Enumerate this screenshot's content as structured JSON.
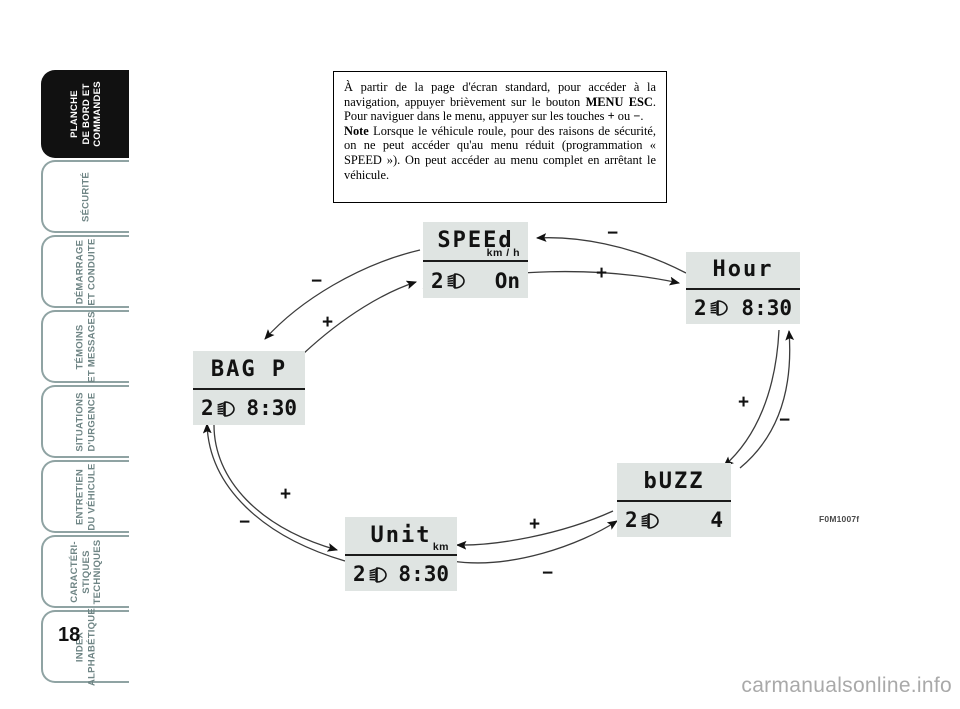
{
  "sidebar": {
    "items": [
      {
        "name": "planche-de-bord",
        "label": "PLANCHE\nDE BORD ET\nCOMMANDES",
        "active": true
      },
      {
        "name": "securite",
        "label": "SÉCURITÉ",
        "active": false
      },
      {
        "name": "demarrage",
        "label": "DÉMARRAGE\nET CONDUITE",
        "active": false
      },
      {
        "name": "temoins",
        "label": "TÉMOINS\nET MESSAGES",
        "active": false
      },
      {
        "name": "situations-urgence",
        "label": "SITUATIONS\nD'URGENCE",
        "active": false
      },
      {
        "name": "entretien",
        "label": "ENTRETIEN\nDU VÉHICULE",
        "active": false
      },
      {
        "name": "caracteristiques",
        "label": "CARACTÉRI-\nSTIQUES\nTECHNIQUES",
        "active": false
      },
      {
        "name": "index",
        "label": "INDEX\nALPHABÉTIQUE",
        "active": false
      }
    ],
    "page_number": "18"
  },
  "note": {
    "paragraph1_a": "À partir de la page d'écran standard, pour accéder à la navigation, appuyer brièvement sur le bouton ",
    "paragraph1_b": "MENU ESC",
    "paragraph1_c": ". Pour naviguer dans le menu, appuyer sur les touches ",
    "paragraph1_d": "+",
    "paragraph1_e": " ou ",
    "paragraph1_f": "−",
    "paragraph1_g": ".",
    "paragraph2_b": "Note",
    "paragraph2_c": " Lorsque le véhicule roule, pour des raisons de sécurité, on ne peut accéder qu'au menu réduit (programmation « SPEED »). On peut accéder au menu complet en arrêtant le véhicule."
  },
  "displays": [
    {
      "name": "speed",
      "title": "SPEEd",
      "unit": "km / h",
      "gear": "2",
      "value": "On"
    },
    {
      "name": "hour",
      "title": "Hour",
      "unit": "",
      "gear": "2",
      "value": "8:30"
    },
    {
      "name": "buzz",
      "title": "bUZZ",
      "unit": "",
      "gear": "2",
      "value": "4"
    },
    {
      "name": "unit",
      "title": "Unit",
      "unit": "km",
      "gear": "2",
      "value": "8:30"
    },
    {
      "name": "bag-p",
      "title": "BAG P",
      "unit": "",
      "gear": "2",
      "value": "8:30"
    }
  ],
  "operators": {
    "minus": "−",
    "plus": "+"
  },
  "figure_code": "F0M1007f",
  "watermark": "carmanualsonline.info",
  "colors": {
    "lcd_background": "#dfe4e2",
    "tab_border": "#8fa3a3",
    "tab_text": "#6f8585",
    "active_tab": "#111111"
  }
}
